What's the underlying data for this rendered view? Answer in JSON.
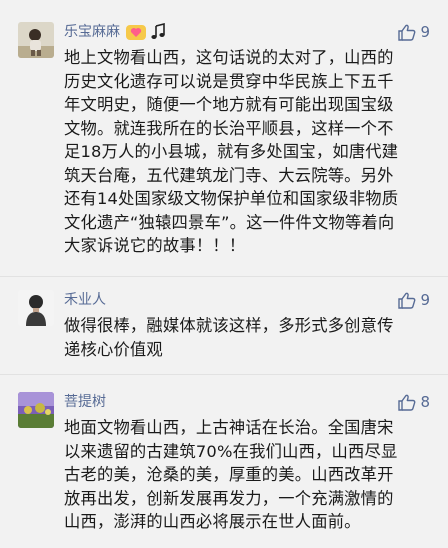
{
  "comments": [
    {
      "name": "乐宝麻麻",
      "likes": "9",
      "lines": [
        "地上文物看山西，这句话说的太对了，山西的",
        "历史文化遗存可以说是贯穿中华民族上下五千",
        "年文明史，随便一个地方就有可能出现国宝级",
        "文物。就连我所在的长治平顺县，这样一个不",
        "足18万人的小县城，就有多处国宝，如唐代建",
        "筑天台庵，五代建筑龙门寺、大云院等。另外",
        "还有14处国家级文物保护单位和国家级非物质",
        "文化遗产“独辕四景车”。这一件件文物等着向",
        "大家诉说它的故事！！！"
      ]
    },
    {
      "name": "禾业人",
      "likes": "9",
      "lines": [
        "做得很棒，融媒体就该这样，多形式多创意传",
        "递核心价值观"
      ]
    },
    {
      "name": "菩提树",
      "likes": "8",
      "lines": [
        "地面文物看山西，上古神话在长治。全国唐宋",
        "以来遗留的古建筑70%在我们山西，山西尽显",
        "古老的美，沧桑的美，厚重的美。山西改革开",
        "放再出发，创新发展再发力，一个充满激情的",
        "山西，澎湃的山西必将展示在世人面前。"
      ]
    }
  ],
  "colors": {
    "name": "#576b95",
    "text": "#1a1a1a",
    "background": "#f2f2f2"
  },
  "icons": {
    "like": "thumbs-up-icon",
    "badge1": "heart-badge-icon",
    "badge2": "music-note-icon"
  }
}
